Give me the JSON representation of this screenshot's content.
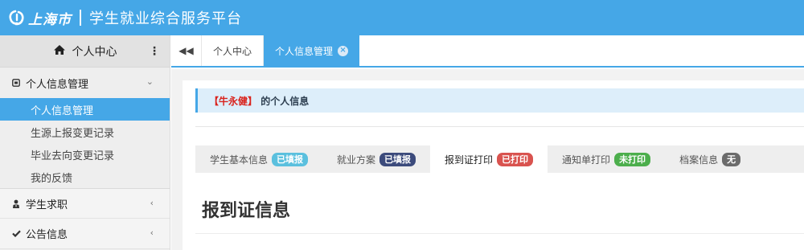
{
  "header": {
    "city": "上海市",
    "title": "学生就业综合服务平台",
    "bg_color": "#45a7e7"
  },
  "sidebar": {
    "top": {
      "icon": "home-icon",
      "label": "个人中心",
      "more_icon": "more-vertical-icon"
    },
    "groups": [
      {
        "label": "个人信息管理",
        "icon": "square-box-icon",
        "expanded": true,
        "items": [
          {
            "label": "个人信息管理",
            "active": true
          },
          {
            "label": "生源上报变更记录",
            "active": false
          },
          {
            "label": "毕业去向变更记录",
            "active": false
          },
          {
            "label": "我的反馈",
            "active": false
          }
        ]
      },
      {
        "label": "学生求职",
        "icon": "person-tie-icon",
        "expanded": false
      },
      {
        "label": "公告信息",
        "icon": "check-icon",
        "expanded": false
      }
    ]
  },
  "tabs": {
    "back_icon": "double-chevron-left-icon",
    "items": [
      {
        "label": "个人中心",
        "active": false
      },
      {
        "label": "个人信息管理",
        "active": true,
        "closable": true
      }
    ]
  },
  "content": {
    "notice": {
      "name": "【牛永健】",
      "suffix": " 的个人信息"
    },
    "subtabs": [
      {
        "label": "学生基本信息",
        "badge": "已填报",
        "badge_color": "#5bc0de",
        "active": false
      },
      {
        "label": "就业方案",
        "badge": "已填报",
        "badge_color": "#3c4b7c",
        "active": false
      },
      {
        "label": "报到证打印",
        "badge": "已打印",
        "badge_color": "#d9534f",
        "active": true
      },
      {
        "label": "通知单打印",
        "badge": "未打印",
        "badge_color": "#4cae4c",
        "active": false
      },
      {
        "label": "档案信息",
        "badge": "无",
        "badge_color": "#6b6b6b",
        "active": false
      }
    ],
    "section_title": "报到证信息"
  }
}
